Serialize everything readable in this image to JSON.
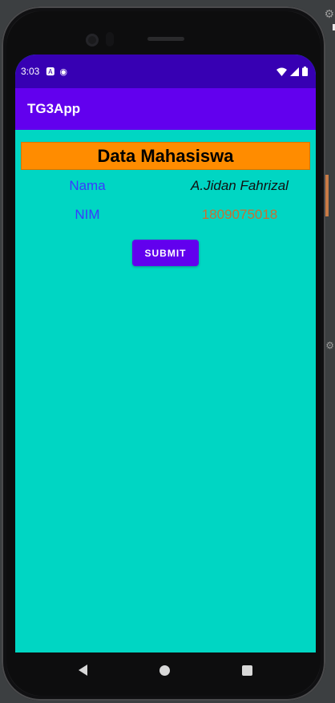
{
  "status_bar": {
    "time": "3:03",
    "icons": [
      "app-a-icon",
      "notification-p-icon",
      "wifi-icon",
      "signal-icon",
      "battery-icon"
    ]
  },
  "app_bar": {
    "title": "TG3App"
  },
  "main": {
    "header": "Data Mahasiswa",
    "fields": [
      {
        "label": "Nama",
        "value": "A.Jidan Fahrizal"
      },
      {
        "label": "NIM",
        "value": "1809075018"
      }
    ],
    "submit_label": "SUBMIT"
  },
  "nav_bar": {
    "icons": [
      "back-icon",
      "home-icon",
      "recents-icon"
    ]
  },
  "colors": {
    "status_bar": "#3700b3",
    "app_bar": "#6200ee",
    "background": "#00d6c3",
    "header_bg": "#ff8c00",
    "label": "#3a3aff",
    "nim_value": "#c87032",
    "button": "#6200ee"
  }
}
